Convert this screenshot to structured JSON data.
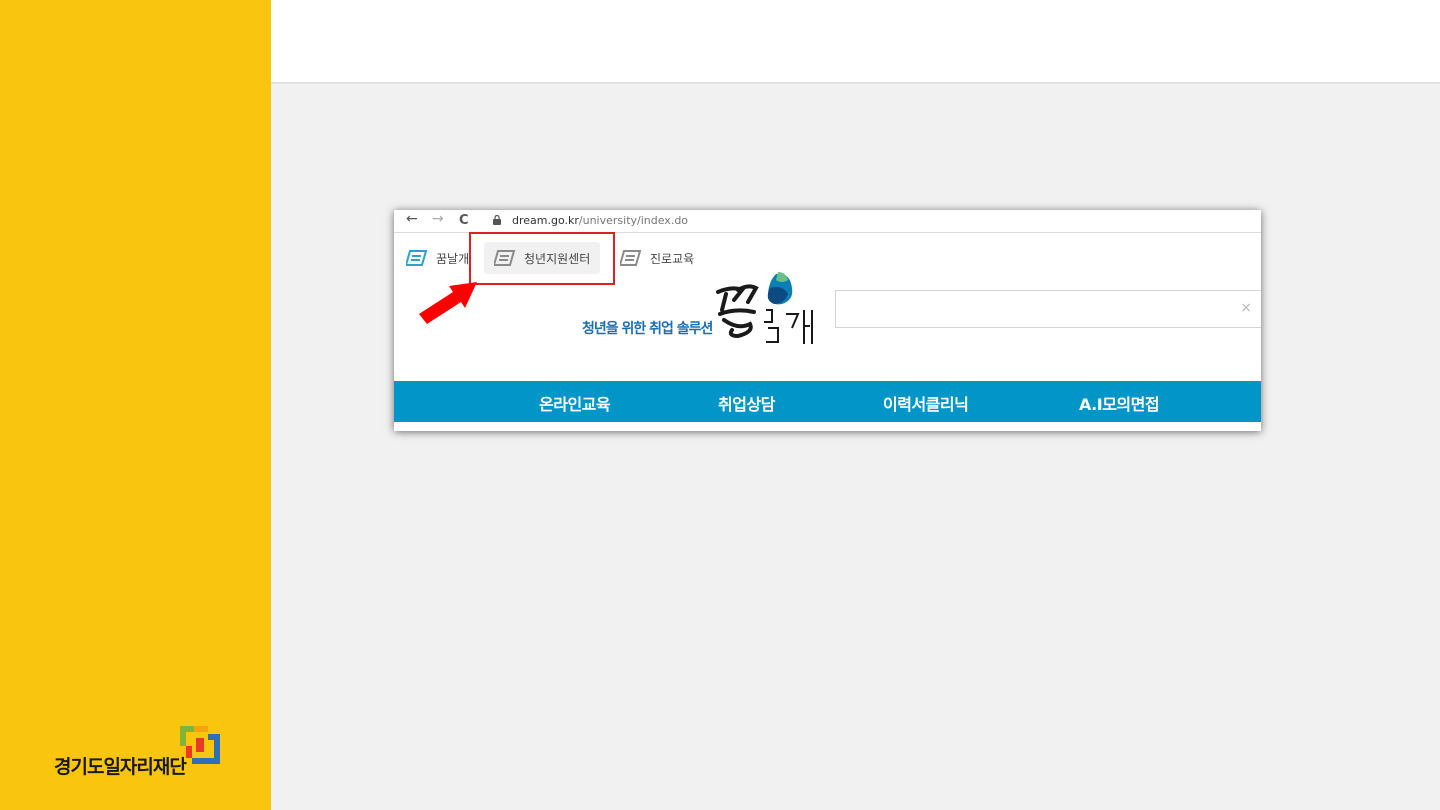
{
  "organization": {
    "name": "경기도일자리재단",
    "logo_colors": [
      "#e8382b",
      "#2e6fb7",
      "#7fb539",
      "#f4a30c"
    ]
  },
  "browser": {
    "url_domain": "dream.go.kr",
    "url_path": "/university/index.do",
    "icons": [
      "back-arrow-icon",
      "forward-arrow-icon",
      "reload-icon",
      "lock-icon"
    ],
    "nav_glyphs": {
      "back": "←",
      "forward": "→",
      "reload": "C"
    }
  },
  "bookmarks": [
    {
      "label": "꿈날개",
      "active": false
    },
    {
      "label": "청년지원센터",
      "active": true
    },
    {
      "label": "진로교육",
      "active": false
    }
  ],
  "site": {
    "tagline": "청년을 위한 취업 솔루션",
    "logo_text": "꿈날개",
    "search_clear_glyph": "×"
  },
  "menu": [
    {
      "label": "온라인교육"
    },
    {
      "label": "취업상담"
    },
    {
      "label": "이력서클리닉"
    },
    {
      "label": "A.I모의면접"
    }
  ],
  "colors": {
    "sidebar": "#f9c50f",
    "menu_bar": "#0296c8",
    "highlight": "#e02020",
    "tagline": "#1d6fb2"
  }
}
